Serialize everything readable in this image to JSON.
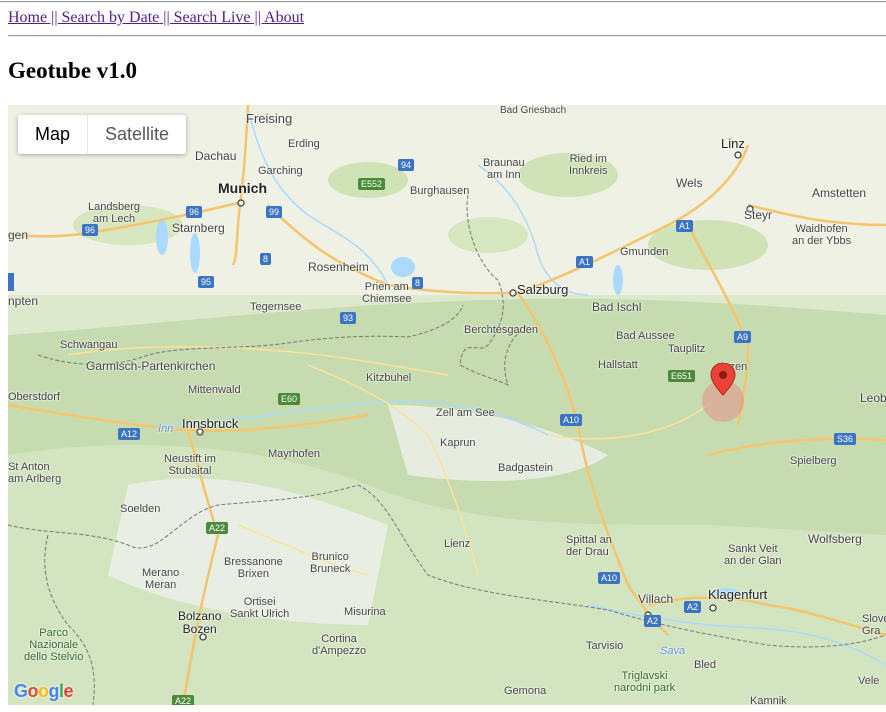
{
  "nav": {
    "home": "Home",
    "sep1": " || ",
    "search_by_date": "Search by Date",
    "sep2": " || ",
    "search_live": "Search Live",
    "sep3": " || ",
    "about": "About"
  },
  "page": {
    "title": "Geotube v1.0"
  },
  "map": {
    "type_control": {
      "map": "Map",
      "satellite": "Satellite",
      "selected": "Map"
    },
    "attribution": "Google",
    "labels": {
      "freising": "Freising",
      "erding": "Erding",
      "dachau": "Dachau",
      "munich": "Munich",
      "garching": "Garching",
      "bad_griesbach": "Bad Griesbach",
      "braunau": "Braunau\nam Inn",
      "ried": "Ried im\nInnkreis",
      "linz": "Linz",
      "wels": "Wels",
      "amstetten": "Amstetten",
      "steyr": "Steyr",
      "waidhofen": "Waidhofen\nan der Ybbs",
      "landsberg": "Landsberg\nam Lech",
      "starnberg": "Starnberg",
      "burghausen": "Burghausen",
      "gen": "gen",
      "rosenheim": "Rosenheim",
      "prien": "Prien am\nChiemsee",
      "salzburg": "Salzburg",
      "gmunden": "Gmunden",
      "bad_ischl": "Bad Ischl",
      "npten": "npten",
      "tegernsee": "Tegernsee",
      "berchtesgaden": "Berchtesgaden",
      "bad_aussee": "Bad Aussee",
      "tauplitz": "Tauplitz",
      "schwangau": "Schwangau",
      "hallstatt": "Hallstatt",
      "garmisch": "Garmisch-Partenkirchen",
      "mittenwald": "Mittenwald",
      "kitzbuhel": "Kitzbuhel",
      "liezen": "iezen",
      "oberstdorf": "Oberstdorf",
      "zell": "Zell am See",
      "leob": "Leob",
      "innsbruck": "Innsbruck",
      "kaprun": "Kaprun",
      "neustift": "Neustift im\nStubaital",
      "mayrhofen": "Mayrhofen",
      "st_anton": "St Anton\nam Arlberg",
      "badgastein": "Badgastein",
      "spielberg": "Spielberg",
      "soelden": "Soelden",
      "wolfsberg": "Wolfsberg",
      "lienz": "Lienz",
      "spittal": "Spittal an\nder Drau",
      "st_veit": "Sankt Veit\nan der Glan",
      "merano": "Merano\nMeran",
      "bressanone": "Bressanone\nBrixen",
      "brunico": "Brunico\nBruneck",
      "bolzano": "Bolzano\nBozen",
      "ortisei": "Ortisei\nSankt Ulrich",
      "villach": "Villach",
      "klagenfurt": "Klagenfurt",
      "misurina": "Misurina",
      "parco": "Parco\nNazionale\ndello Stelvio",
      "cortina": "Cortina\nd'Ampezzo",
      "tarvisio": "Tarvisio",
      "bled": "Bled",
      "triglavski": "Triglavski\nnarodni park",
      "slove": "Slove\nGra",
      "gemona": "Gemona",
      "kamnik": "Kamnik",
      "velenje": "Vele",
      "inn": "Inn",
      "sava": "Sava"
    },
    "shields": {
      "a94": "94",
      "e552": "E552",
      "a96a": "96",
      "a99": "99",
      "a96b": "96",
      "a8a": "8",
      "a95": "95",
      "a8b": "8",
      "a93": "93",
      "a1a": "A1",
      "a1b": "A1",
      "a9": "A9",
      "e651": "E651",
      "e60": "E60",
      "a12": "A12",
      "a10a": "A10",
      "s36": "S36",
      "a22a": "A22",
      "a10b": "A10",
      "a2a": "A2",
      "a2b": "A2",
      "a22b": "A22"
    }
  }
}
